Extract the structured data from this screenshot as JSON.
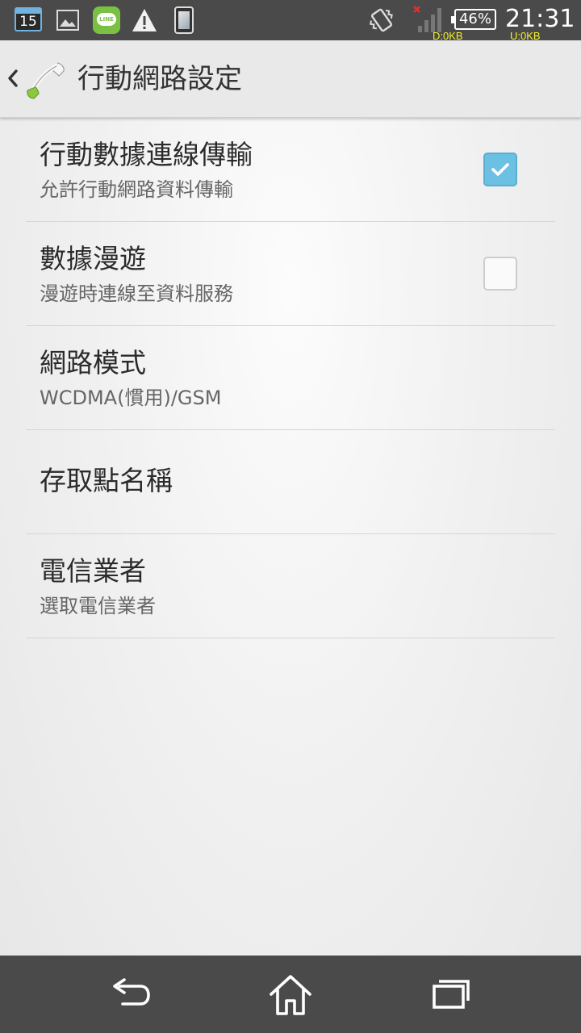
{
  "status_bar": {
    "calendar_day": "15",
    "battery_percent": "46%",
    "time": "21:31",
    "download_rate": "D:0KB",
    "upload_rate": "U:0KB",
    "icons": [
      "calendar-icon",
      "gallery-icon",
      "line-app-icon",
      "warning-icon",
      "phone-screen-icon",
      "vibrate-icon",
      "signal-icon",
      "battery-icon"
    ],
    "line_badge": "LINE",
    "traffic_color": "#f5ef2a"
  },
  "action_bar": {
    "title": "行動網路設定",
    "icon": "phone-handset-icon"
  },
  "settings": [
    {
      "title": "行動數據連線傳輸",
      "summary": "允許行動網路資料傳輸",
      "checked": true
    },
    {
      "title": "數據漫遊",
      "summary": "漫遊時連線至資料服務",
      "checked": false
    },
    {
      "title": "網路模式",
      "summary": "WCDMA(慣用)/GSM"
    },
    {
      "title": "存取點名稱",
      "summary": ""
    },
    {
      "title": "電信業者",
      "summary": "選取電信業者"
    }
  ],
  "nav_bar": {
    "buttons": [
      "back-icon",
      "home-icon",
      "recent-apps-icon"
    ]
  },
  "colors": {
    "checkbox_checked": "#6cc0e2",
    "status_bar_bg": "#4a4a4a",
    "action_bar_bg": "#e9e9e9"
  }
}
